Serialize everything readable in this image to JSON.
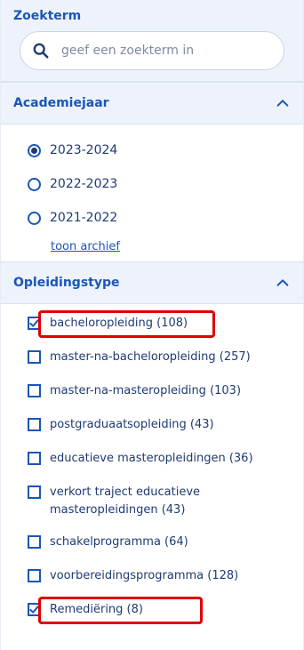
{
  "search": {
    "title": "Zoekterm",
    "placeholder": "geef een zoekterm in",
    "icon": "search-icon"
  },
  "academic_year": {
    "title": "Academiejaar",
    "options": [
      {
        "label": "2023-2024",
        "selected": true
      },
      {
        "label": "2022-2023",
        "selected": false
      },
      {
        "label": "2021-2022",
        "selected": false
      }
    ],
    "archive_link": "toon archief"
  },
  "education_type": {
    "title": "Opleidingstype",
    "options": [
      {
        "label": "bacheloropleiding (108)",
        "checked": true
      },
      {
        "label": "master-na-bacheloropleiding (257)",
        "checked": false
      },
      {
        "label": "master-na-masteropleiding (103)",
        "checked": false
      },
      {
        "label": "postgraduaatsopleiding (43)",
        "checked": false
      },
      {
        "label": "educatieve masteropleidingen (36)",
        "checked": false
      },
      {
        "label": "verkort traject educatieve masteropleidingen (43)",
        "checked": false
      },
      {
        "label": "schakelprogramma (64)",
        "checked": false
      },
      {
        "label": "voorbereidingsprogramma (128)",
        "checked": false
      },
      {
        "label": "Remediëring (8)",
        "checked": true
      }
    ]
  },
  "colors": {
    "accent": "#1a56b8",
    "highlight": "#e00000",
    "header_bg": "#eef3fb"
  }
}
